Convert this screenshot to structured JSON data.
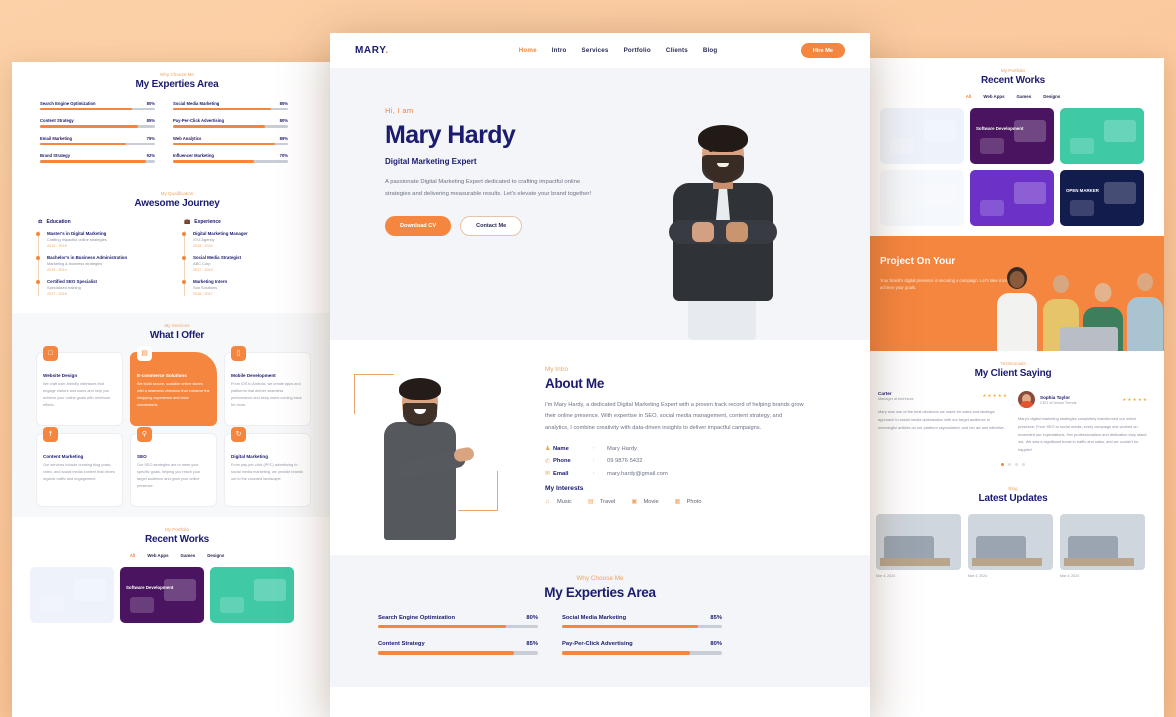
{
  "theme": {
    "accent": "#f5863f",
    "navy": "#1b1b6f",
    "page_bg": "#fcd1a8",
    "section_bg": "#f3f5f8"
  },
  "center": {
    "nav": {
      "logo": "MARY",
      "logo_dot": ".",
      "items": [
        "Home",
        "Intro",
        "Services",
        "Portfolio",
        "Clients",
        "Blog"
      ],
      "cta": "Hire Me"
    },
    "hero": {
      "greeting": "Hi, I am",
      "name": "Mary Hardy",
      "role": "Digital Marketing Expert",
      "description": "A passionate Digital Marketing Expert dedicated to crafting impactful online strategies and delivering measurable results. Let's elevate your brand together!",
      "primary_button": "Download CV",
      "secondary_button": "Contact Me"
    },
    "about": {
      "kicker": "My Intro",
      "title": "About Me",
      "description": "I'm Mary Hardy, a dedicated Digital Marketing Expert with a proven track record of helping brands grow their online presence. With expertise in SEO, social media management, content strategy, and analytics, I combine creativity with data-driven insights to deliver impactful campaigns.",
      "info": [
        {
          "icon": "user-icon",
          "label": "Name",
          "sep": ":",
          "value": "Mary Hardy"
        },
        {
          "icon": "phone-icon",
          "label": "Phone",
          "sep": ":",
          "value": "09 9876 5432"
        },
        {
          "icon": "envelope-icon",
          "label": "Email",
          "sep": ":",
          "value": "mary.hardy@gmail.com"
        }
      ],
      "interests_title": "My Interests",
      "interests": [
        {
          "icon": "headphones-icon",
          "label": "Music"
        },
        {
          "icon": "briefcase-icon",
          "label": "Travel"
        },
        {
          "icon": "film-icon",
          "label": "Movie"
        },
        {
          "icon": "camera-icon",
          "label": "Photo"
        }
      ]
    },
    "expertise": {
      "kicker": "Why Choose Me",
      "title": "My Experties Area",
      "skills": [
        {
          "name": "Search Engine Optimization",
          "value": "80%",
          "pct": 80
        },
        {
          "name": "Social Media Marketing",
          "value": "85%",
          "pct": 85
        },
        {
          "name": "Content Strategy",
          "value": "85%",
          "pct": 85
        },
        {
          "name": "Pay-Per-Click Advertising",
          "value": "80%",
          "pct": 80
        }
      ]
    }
  },
  "left": {
    "expertise": {
      "kicker": "Why Choose Me",
      "title": "My Experties Area",
      "skills": [
        {
          "name": "Search Engine Optimization",
          "value": "80%",
          "pct": 80
        },
        {
          "name": "Social Media Marketing",
          "value": "85%",
          "pct": 85
        },
        {
          "name": "Content Strategy",
          "value": "85%",
          "pct": 85
        },
        {
          "name": "Pay-Per-Click Advertising",
          "value": "80%",
          "pct": 80
        },
        {
          "name": "Email Marketing",
          "value": "75%",
          "pct": 75
        },
        {
          "name": "Web Analytics",
          "value": "89%",
          "pct": 89
        },
        {
          "name": "Brand Strategy",
          "value": "92%",
          "pct": 92
        },
        {
          "name": "Influencer Marketing",
          "value": "70%",
          "pct": 70
        }
      ]
    },
    "journey": {
      "kicker": "My Qualification",
      "title": "Awesome Journey",
      "education_title": "Education",
      "experience_title": "Experience",
      "education": [
        {
          "title": "Master's in Digital Marketing",
          "desc": "Crafting impactful online strategies",
          "year": "2014 - 2016"
        },
        {
          "title": "Bachelor's in Business Administration",
          "desc": "Marketing & business strategies",
          "year": "2010 - 2014"
        },
        {
          "title": "Certified SEO Specialist",
          "desc": "Specialized training",
          "year": "2017 - 2018"
        }
      ],
      "experience": [
        {
          "title": "Digital Marketing Manager",
          "desc": "XYZ Agency",
          "year": "2019 - 2024"
        },
        {
          "title": "Social Media Strategist",
          "desc": "ABC Corp",
          "year": "2017 - 2019"
        },
        {
          "title": "Marketing Intern",
          "desc": "Sun Solutions",
          "year": "2016 - 2017"
        }
      ]
    },
    "services": {
      "kicker": "My Services",
      "title": "What I Offer",
      "cards": [
        {
          "icon": "monitor-icon",
          "title": "Website Design",
          "desc": "We craft user-friendly interfaces that engage visitors and users and help you achieve your online goals with minimum efforts.",
          "highlight": false
        },
        {
          "icon": "cart-icon",
          "title": "E-commerce Solutions",
          "desc": "We build secure, scalable online stores with a seamless checkout that enhance the shopping experience and drive conversions.",
          "highlight": true
        },
        {
          "icon": "mobile-icon",
          "title": "Mobile Development",
          "desc": "From iOS to Android, we create apps and platforms that deliver seamless performance and keep users coming back for more.",
          "highlight": false
        },
        {
          "icon": "share-icon",
          "title": "Content Marketing",
          "desc": "Our services include creating blog posts, video, and social media content that drives organic traffic and engagement.",
          "highlight": false
        },
        {
          "icon": "search-icon",
          "title": "SEO",
          "desc": "Our SEO strategies are to meet your specific goals, helping you reach your target audience and grow your online presence.",
          "highlight": false
        },
        {
          "icon": "refresh-icon",
          "title": "Digital Marketing",
          "desc": "From pay-per-click (PPC) advertising to social media marketing, we provide brands out to the crowded landscape.",
          "highlight": false
        }
      ]
    },
    "portfolio": {
      "kicker": "My Portfolio",
      "title": "Recent Works",
      "filters": [
        "All",
        "Web Apps",
        "Games",
        "Designs"
      ],
      "works": [
        {
          "label": "",
          "bg": "#eef3fb"
        },
        {
          "label": "Software Development",
          "bg": "#4a1460"
        },
        {
          "label": "",
          "bg": "#3fc9a4"
        }
      ]
    }
  },
  "right": {
    "portfolio": {
      "kicker": "My Portfolio",
      "title": "Recent Works",
      "filters": [
        "All",
        "Web Apps",
        "Games",
        "Designs"
      ],
      "works": [
        {
          "label": "",
          "bg": "#eef3fb"
        },
        {
          "label": "Software Development",
          "bg": "#4a1460"
        },
        {
          "label": "",
          "bg": "#3fc9a4"
        },
        {
          "label": "",
          "bg": "#f5f8fc"
        },
        {
          "label": "",
          "bg": "#6c32c8"
        },
        {
          "label": "OPEN MARKER",
          "bg": "#121c4d"
        }
      ]
    },
    "cta": {
      "title": "Project On Your",
      "description": "Your brand's digital presence is securing a campaign. Let's take it into you achieve your goals."
    },
    "testimonials": {
      "kicker": "Testimonials",
      "title": "My Client Saying",
      "items": [
        {
          "name": "Carter",
          "role": "Manager at techhove",
          "stars": "★★★★★",
          "body": "Mary was one of the best decisions we made for sales and strategic approach to social media optimization with our target audience in meaningful articles on our platform skyrocketed, and her art and effective."
        },
        {
          "name": "Sophia Taylor",
          "role": "CEO of Urban Trends",
          "stars": "★★★★★",
          "body": "Mary's digital marketing strategies completely transformed our online presence. From SEO to social media, every campaign she worked on exceeded our expectations. Her professionalism and dedication truly stand out. We saw a significant boost in traffic and sales, and we couldn't be happier!"
        }
      ],
      "dots": [
        true,
        false,
        false,
        false
      ]
    },
    "blog": {
      "kicker": "Blog",
      "title": "Latest Updates",
      "posts": [
        {
          "meta": "Mar 4, 2024"
        },
        {
          "meta": "Mar 4, 2024"
        },
        {
          "meta": "Mar 4, 2024"
        }
      ]
    }
  }
}
